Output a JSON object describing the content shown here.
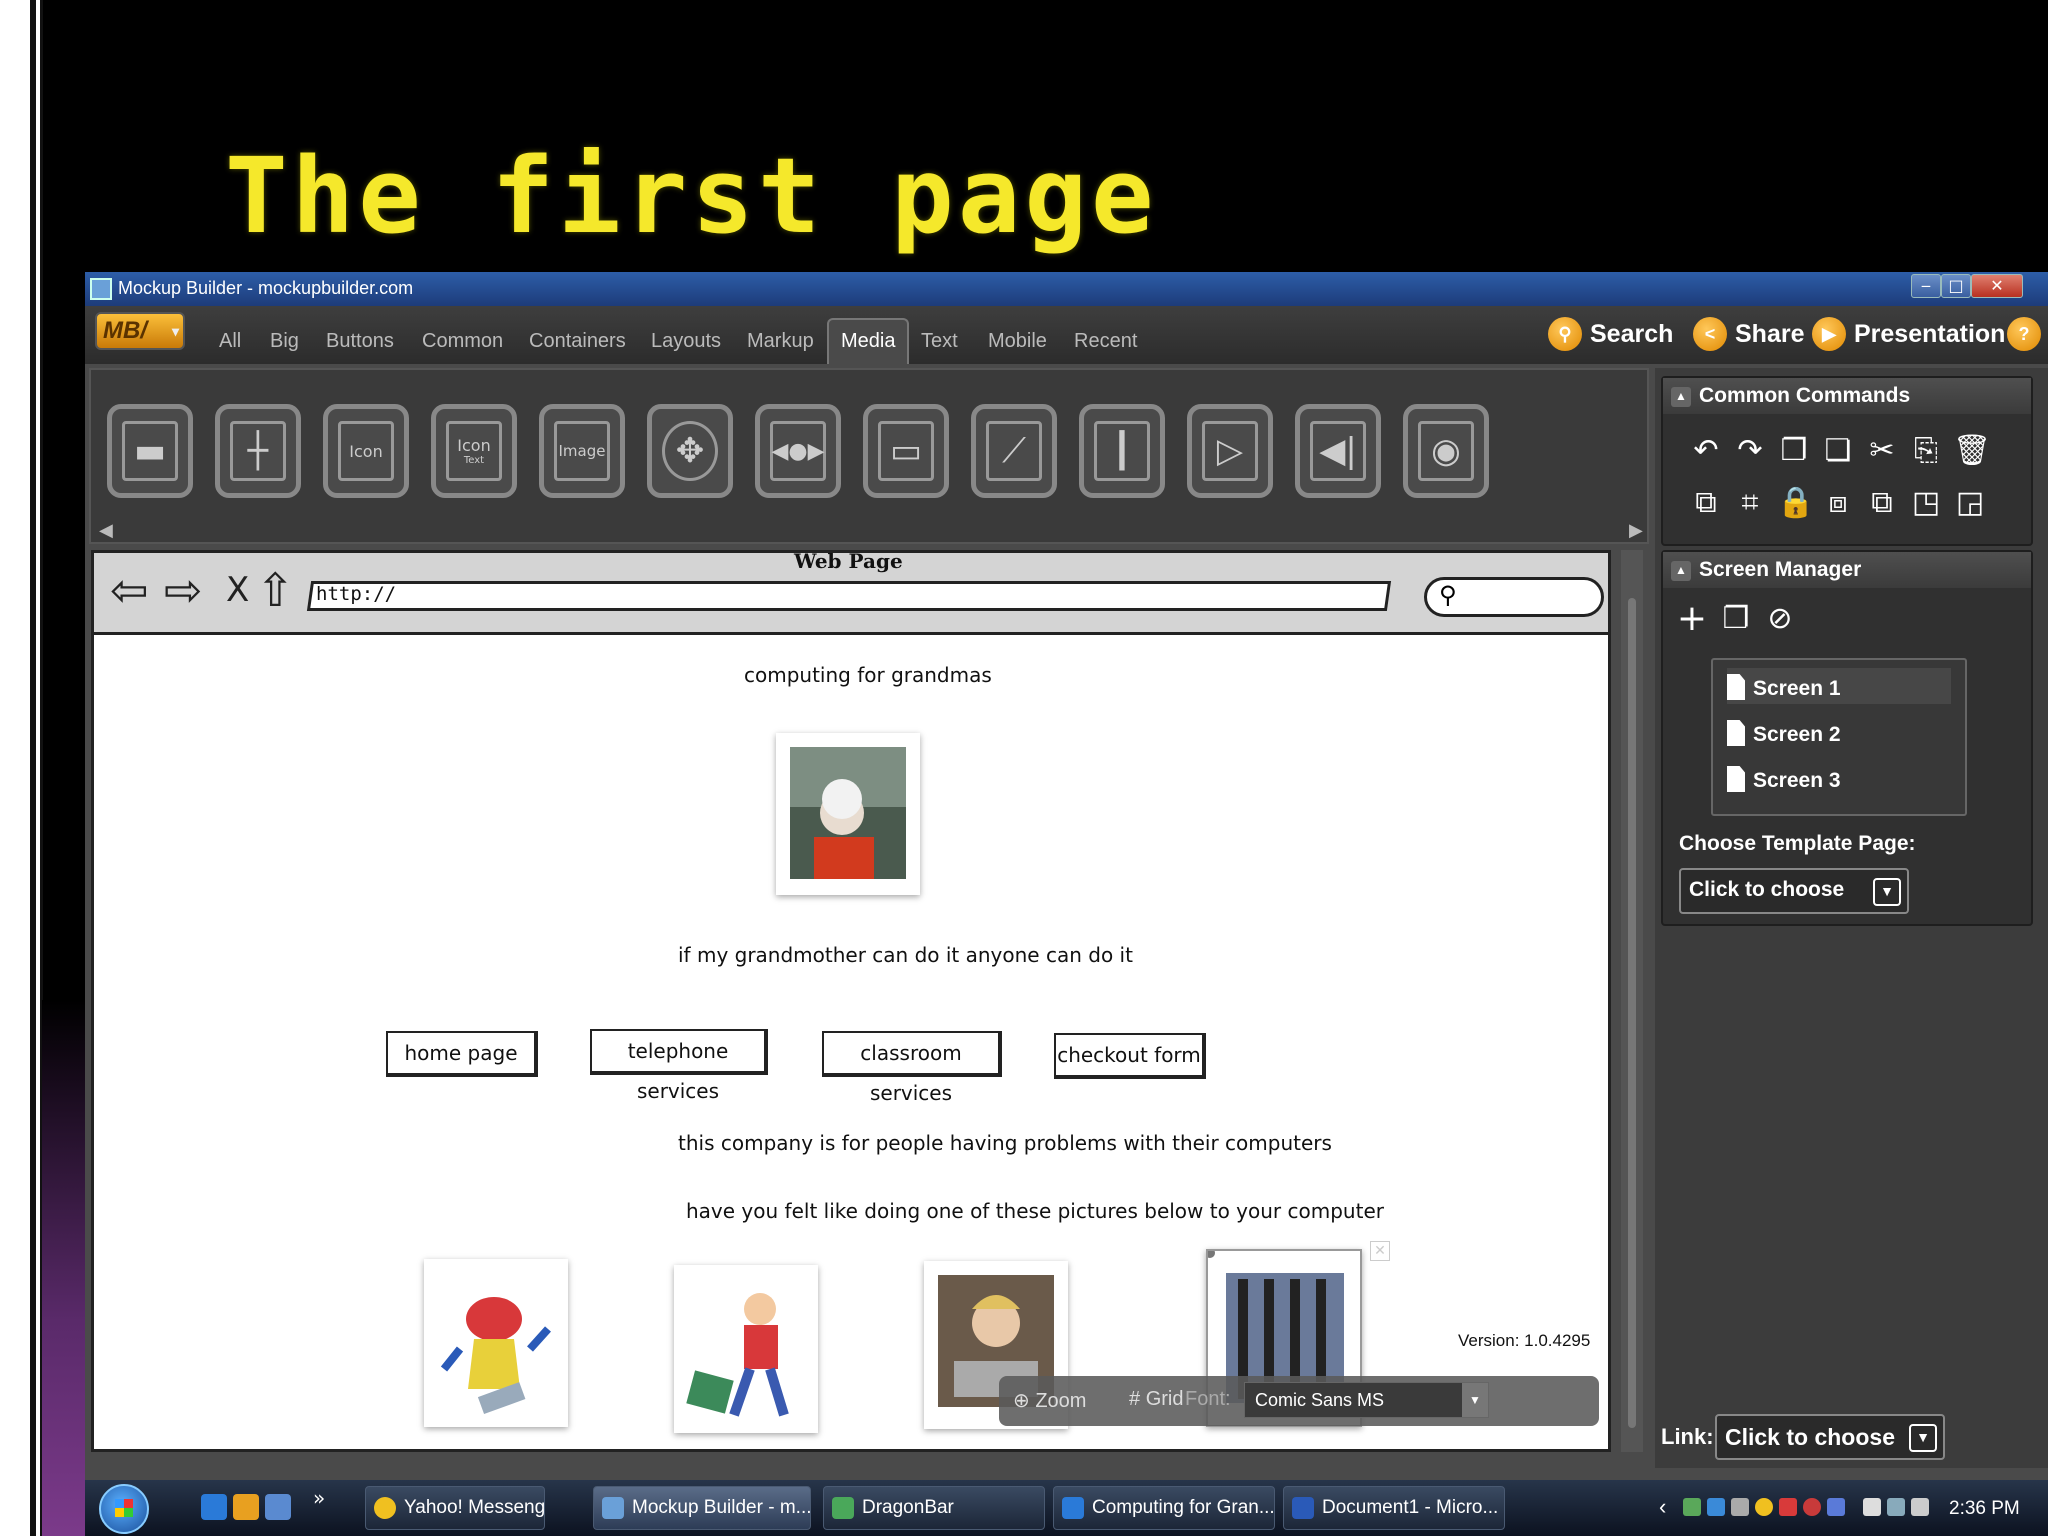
{
  "slide": {
    "title": "The first page"
  },
  "window": {
    "title": "Mockup Builder - mockupbuilder.com",
    "minimize": "‒",
    "maximize": "□",
    "close": "✕"
  },
  "toolbar": {
    "logo": "MB/",
    "tabs": [
      "All",
      "Big",
      "Buttons",
      "Common",
      "Containers",
      "Layouts",
      "Markup",
      "Media",
      "Text",
      "Mobile",
      "Recent"
    ],
    "active_tab": "Media",
    "actions": {
      "search": "Search",
      "share": "Share",
      "presentation": "Presentation",
      "help": "?"
    }
  },
  "component_strip": {
    "items": [
      "video-player",
      "slider",
      "icon",
      "icon-with-text",
      "image",
      "navigation-pad",
      "media-controls",
      "button",
      "chart",
      "vertical-slider",
      "video",
      "volume-control",
      "webcam"
    ],
    "labels": {
      "icon": "Icon",
      "icon_text": "Icon",
      "icon_text_sub": "Text",
      "image": "Image"
    }
  },
  "canvas": {
    "browser": {
      "window_label": "Web Page",
      "url": "http://",
      "search_glyph": "⚲"
    },
    "heading": "computing for grandmas",
    "tagline": "if my grandmother can do it anyone can do it",
    "nav_buttons": [
      "home page",
      "telephone services",
      "classroom services",
      "checkout form"
    ],
    "desc1": "this company is for people having problems with their computers",
    "desc2": "have you felt like doing one of these pictures below to your computer",
    "version": "Version: 1.0.4295"
  },
  "zoom_bar": {
    "zoom": "Zoom",
    "grid": "Grid",
    "font_label": "Font:",
    "font_value": "Comic Sans MS"
  },
  "right_panel": {
    "common_commands": {
      "title": "Common Commands"
    },
    "screen_manager": {
      "title": "Screen Manager",
      "screens": [
        "Screen 1",
        "Screen 2",
        "Screen 3"
      ],
      "selected": "Screen 1",
      "template_label": "Choose Template Page:",
      "template_value": "Click to choose"
    },
    "link": {
      "label": "Link:",
      "value": "Click to choose"
    }
  },
  "taskbar": {
    "buttons": [
      "Yahoo! Messenger",
      "Mockup Builder - m...",
      "DragonBar",
      "Computing for Gran...",
      "Document1 - Micro..."
    ],
    "active": "Mockup Builder - m...",
    "clock": "2:36 PM",
    "overflow": "»",
    "tray_chevron": "‹"
  },
  "colors": {
    "title_yellow": "#f5e82b",
    "accent_orange": "#e08800",
    "window_blue": "#2d5ea8"
  }
}
